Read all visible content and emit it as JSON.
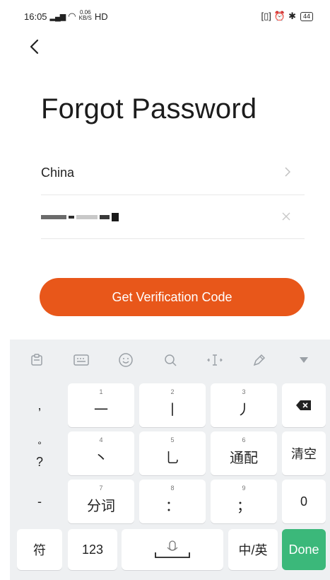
{
  "status_bar": {
    "time": "16:05",
    "signal": "4G",
    "network_speed_value": "0.06",
    "network_speed_unit": "KB/S",
    "hd_label": "HD",
    "battery": "44"
  },
  "page": {
    "title": "Forgot Password"
  },
  "form": {
    "country": "China",
    "phone_masked": true
  },
  "cta": {
    "label": "Get Verification Code"
  },
  "colors": {
    "accent": "#e8571a",
    "done_key": "#3bb87a"
  },
  "keyboard": {
    "toolbar_icons": [
      "clipboard-icon",
      "keyboard-icon",
      "emoji-icon",
      "search-icon",
      "cursor-icon",
      "edit-icon",
      "collapse-icon"
    ],
    "left_column": {
      "k1": ",",
      "k2a": "°",
      "k2b": "?",
      "k3": "-"
    },
    "row1": [
      {
        "num": "1",
        "label": "一"
      },
      {
        "num": "2",
        "label": "丨"
      },
      {
        "num": "3",
        "label": "丿"
      }
    ],
    "row2": [
      {
        "num": "4",
        "label": "丶"
      },
      {
        "num": "5",
        "label": "乚"
      },
      {
        "num": "6",
        "label": "通配"
      }
    ],
    "row3": [
      {
        "num": "7",
        "label": "分词"
      },
      {
        "num": "8",
        "label": "："
      },
      {
        "num": "9",
        "label": "；"
      }
    ],
    "clear_label": "清空",
    "zero_label": "0",
    "symbols_label": "符",
    "numbers_label": "123",
    "lang_label": "中/英",
    "done_label": "Done"
  }
}
